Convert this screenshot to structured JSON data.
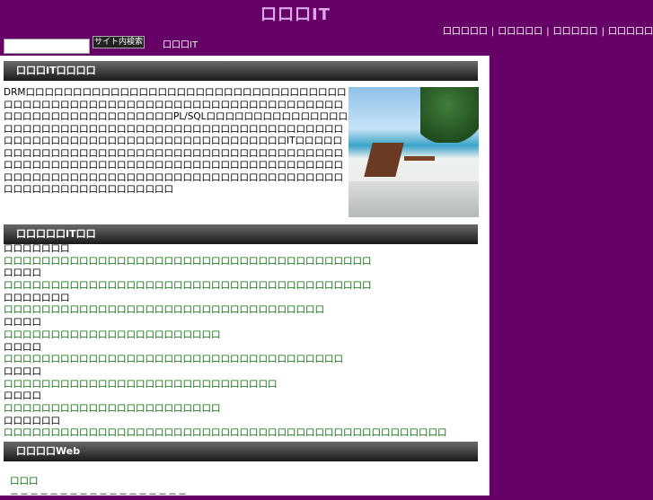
{
  "site": {
    "title": "口口口IT",
    "crumb": "口口口IT"
  },
  "nav": [
    "口口口口口",
    "口口口口口",
    "口口口口口",
    "口口口口口"
  ],
  "nav_sep": "|",
  "search": {
    "value": "",
    "button": "サイト内検索"
  },
  "sections": {
    "intro_header": "口口口IT口口口口",
    "list_header": "口口口口口IT口口",
    "web_header": "口口口口Web"
  },
  "intro": "DRM口口口口口口口口口口口口口口口口口口口口口口口口口口口口口口口口口口口口口口口口口口口口口口口口口口口口口口口口口口口口口口口口口口口口口口口口口口口口口口口口口口口口口口口口PL/SQL口口口口口口口口口口口口口口口口口口口口口口口口口口口口口口口口口口口口口口口口口口口口口口口口口口口口口口口口口口口口口口口口口口口口口口口口口口口口口口口口口IT口口口口口口口口口口口口口口口口口口口口口口口口口口口口口口口口口口口口口口口口口口口口口口口口口口口口口口口口口口口口口口口口口口口口口口口口口口口口口口口口口口口口口口口口口口口口口口口口口口口口口口口口口口口口口口口口口口口口口口口口口口口口口口口口口口口",
  "list": [
    {
      "label": "口口口口口口口"
    },
    {
      "link": "口口口口口口口口口口口口口口口口口口口口口口口口口口口口口口口口口口口口口口口"
    },
    {
      "label": "口口口口"
    },
    {
      "link": "口口口口口口口口口口口口口口口口口口口口口口口口口口口口口口口口口口口口口口口"
    },
    {
      "label": "口口口口口口口"
    },
    {
      "link": "口口口口口口口口口口口口口口口口口口口口口口口口口口口口口口口口口口"
    },
    {
      "label": "口口口口"
    },
    {
      "link": "口口口口口口口口口口口口口口口口口口口口口口口"
    },
    {
      "label": "口口口口"
    },
    {
      "link": "口口口口口口口口口口口口口口口口口口口口口口口口口口口口口口口口口口口口"
    },
    {
      "label": "口口口口"
    },
    {
      "link": "口口口口口口口口口口口口口口口口口口口口口口口口口口口口口"
    },
    {
      "label": "口口口口"
    },
    {
      "link": "口口口口口口口口口口口口口口口口口口口口口口口"
    },
    {
      "label": "口口口口口口"
    },
    {
      "link": "口口口口口口口口口口口口口口口口口口口口口口口口口口口口口口口口口口口口口口口口口口口口口口口"
    }
  ],
  "web_link": "口口口",
  "dash_text": "－－－－－－－－－－－－－－－－－－"
}
